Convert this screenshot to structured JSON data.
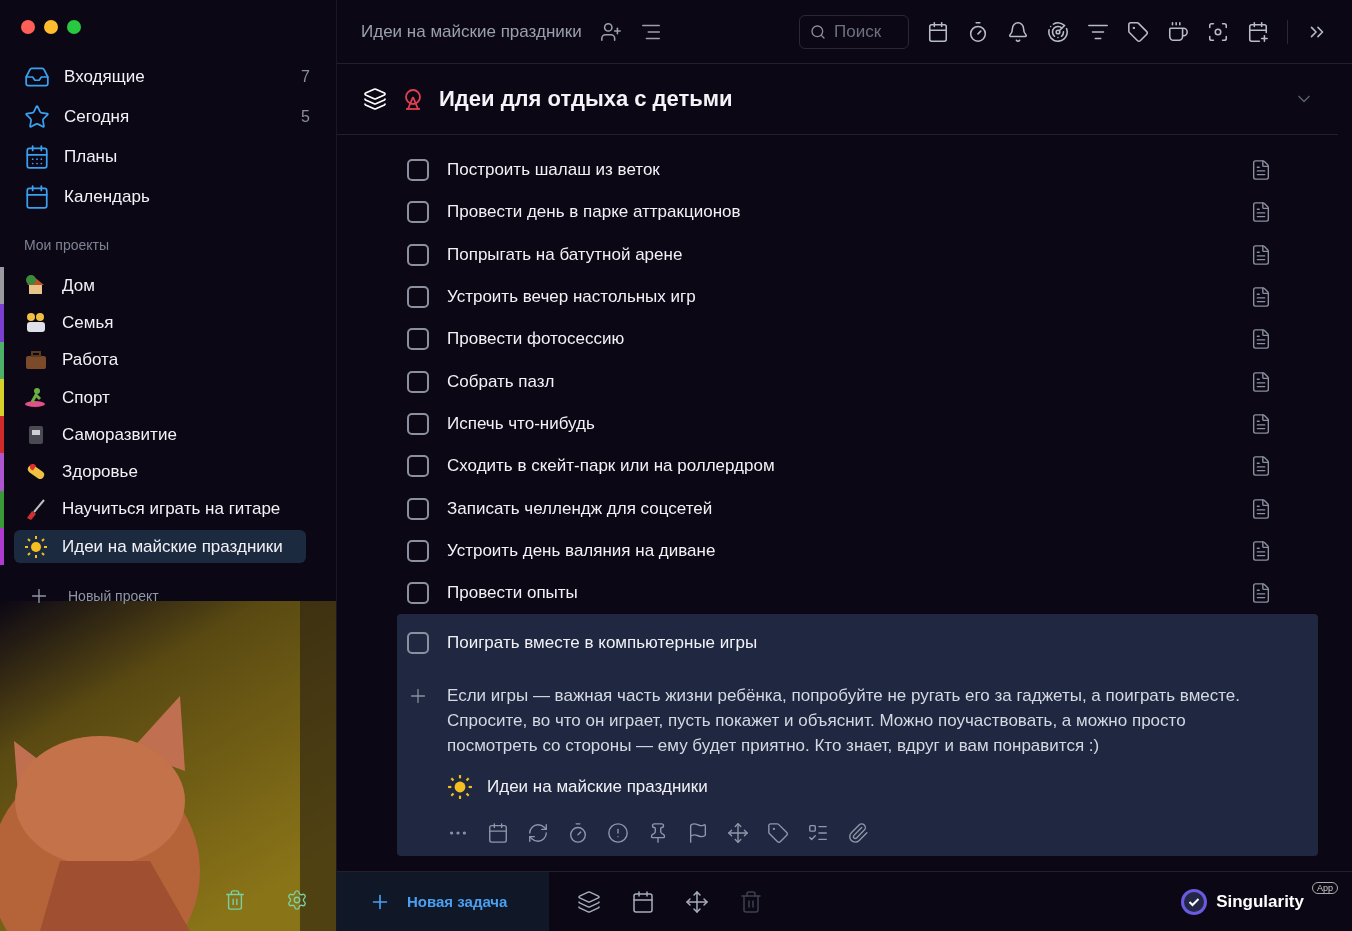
{
  "sidebar": {
    "nav": [
      {
        "label": "Входящие",
        "count": "7"
      },
      {
        "label": "Сегодня",
        "count": "5"
      },
      {
        "label": "Планы"
      },
      {
        "label": "Календарь"
      }
    ],
    "projects_heading": "Мои проекты",
    "projects": [
      {
        "label": "Дом",
        "color": "#9a9aa0",
        "selected": false
      },
      {
        "label": "Семья",
        "color": "#7b3fd0",
        "selected": false
      },
      {
        "label": "Работа",
        "color": "#4fb06a",
        "selected": false
      },
      {
        "label": "Спорт",
        "color": "#d8d02a",
        "selected": false
      },
      {
        "label": "Саморазвитие",
        "color": "#d02a2a",
        "selected": false
      },
      {
        "label": "Здоровье",
        "color": "#b055d0",
        "selected": false
      },
      {
        "label": "Научиться играть на гитаре",
        "color": "#3a9a3a",
        "selected": false
      },
      {
        "label": "Идеи на майские праздники",
        "color": "#b03ad0",
        "selected": true
      }
    ],
    "new_project": "Новый проект"
  },
  "header": {
    "breadcrumb": "Идеи на майские праздники",
    "search": {
      "placeholder": "Поиск"
    }
  },
  "section": {
    "title": "Идеи для отдыха с детьми",
    "expanded": true
  },
  "tasks": [
    {
      "label": "Построить шалаш из веток",
      "checked": false
    },
    {
      "label": "Провести день в парке аттракционов",
      "checked": false
    },
    {
      "label": "Попрыгать на батутной арене",
      "checked": false
    },
    {
      "label": "Устроить вечер настольных игр",
      "checked": false
    },
    {
      "label": "Провести фотосессию",
      "checked": false
    },
    {
      "label": "Собрать пазл",
      "checked": false
    },
    {
      "label": "Испечь что-нибудь",
      "checked": false
    },
    {
      "label": "Сходить в скейт-парк или на роллердром",
      "checked": false
    },
    {
      "label": "Записать челлендж для соцсетей",
      "checked": false
    },
    {
      "label": "Устроить день валяния на диване",
      "checked": false
    },
    {
      "label": "Провести опыты",
      "checked": false
    }
  ],
  "open_task": {
    "label": "Поиграть вместе в компьютерные игры",
    "checked": false,
    "note": "Если игры — важная часть жизни ребёнка, попробуйте не ругать его за гаджеты, а поиграть вместе. Спросите, во что он играет, пусть покажет и объяснит. Можно поучаствовать, а можно просто посмотреть со стороны — ему будет приятно. Кто знает, вдруг и вам понравится :)",
    "project": "Идеи на майские праздники"
  },
  "bottom_bar": {
    "new_task": "Новая задача",
    "brand": "Singularity",
    "brand_badge": "App"
  }
}
